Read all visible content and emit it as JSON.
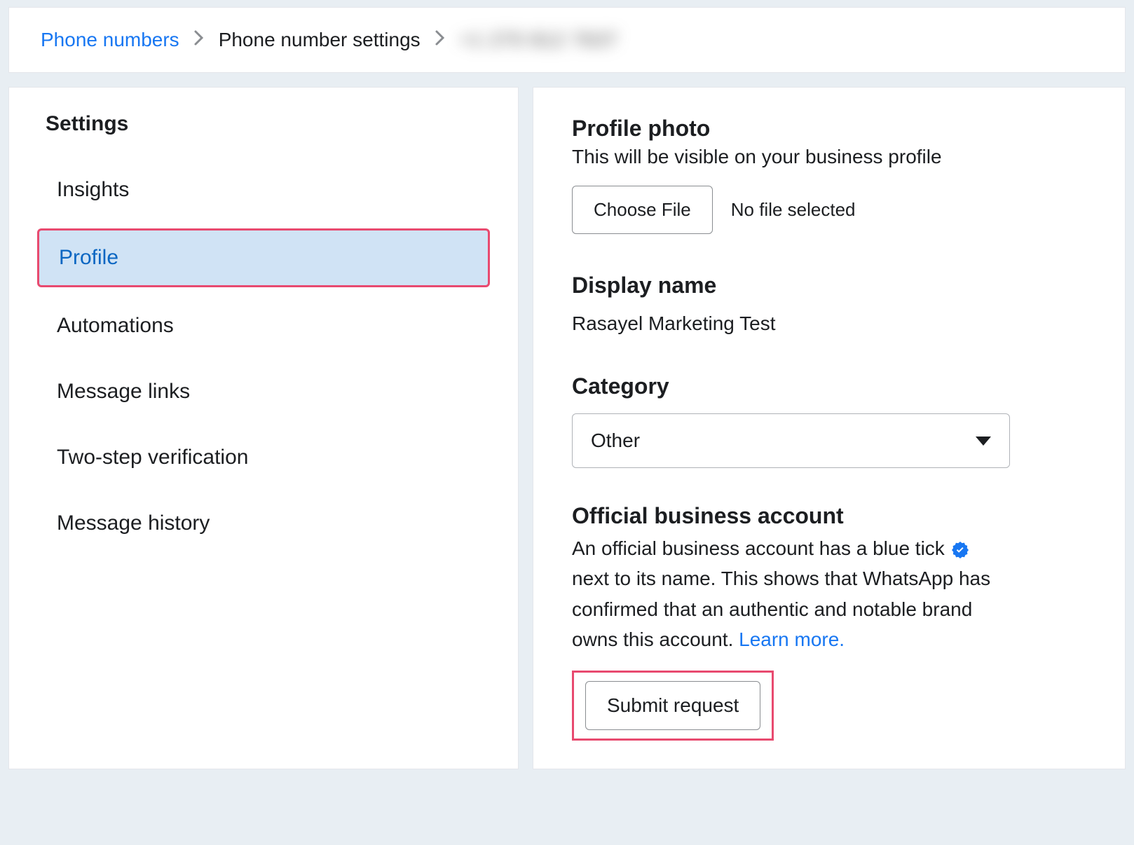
{
  "breadcrumb": {
    "link1": "Phone numbers",
    "text2": "Phone number settings",
    "blurred": "+1 270 812 7637"
  },
  "sidebar": {
    "title": "Settings",
    "items": [
      {
        "label": "Insights",
        "active": false
      },
      {
        "label": "Profile",
        "active": true
      },
      {
        "label": "Automations",
        "active": false
      },
      {
        "label": "Message links",
        "active": false
      },
      {
        "label": "Two-step verification",
        "active": false
      },
      {
        "label": "Message history",
        "active": false
      }
    ]
  },
  "main": {
    "profile_photo": {
      "heading": "Profile photo",
      "sub": "This will be visible on your business profile",
      "choose_btn": "Choose File",
      "status": "No file selected"
    },
    "display_name": {
      "heading": "Display name",
      "value": "Rasayel Marketing Test"
    },
    "category": {
      "heading": "Category",
      "selected": "Other"
    },
    "oba": {
      "heading": "Official business account",
      "desc_pre": "An official business account has a blue tick ",
      "desc_post": " next to its name. This shows that WhatsApp has confirmed that an authentic and notable brand owns this account. ",
      "learn_more": "Learn more.",
      "submit_btn": "Submit request"
    }
  }
}
